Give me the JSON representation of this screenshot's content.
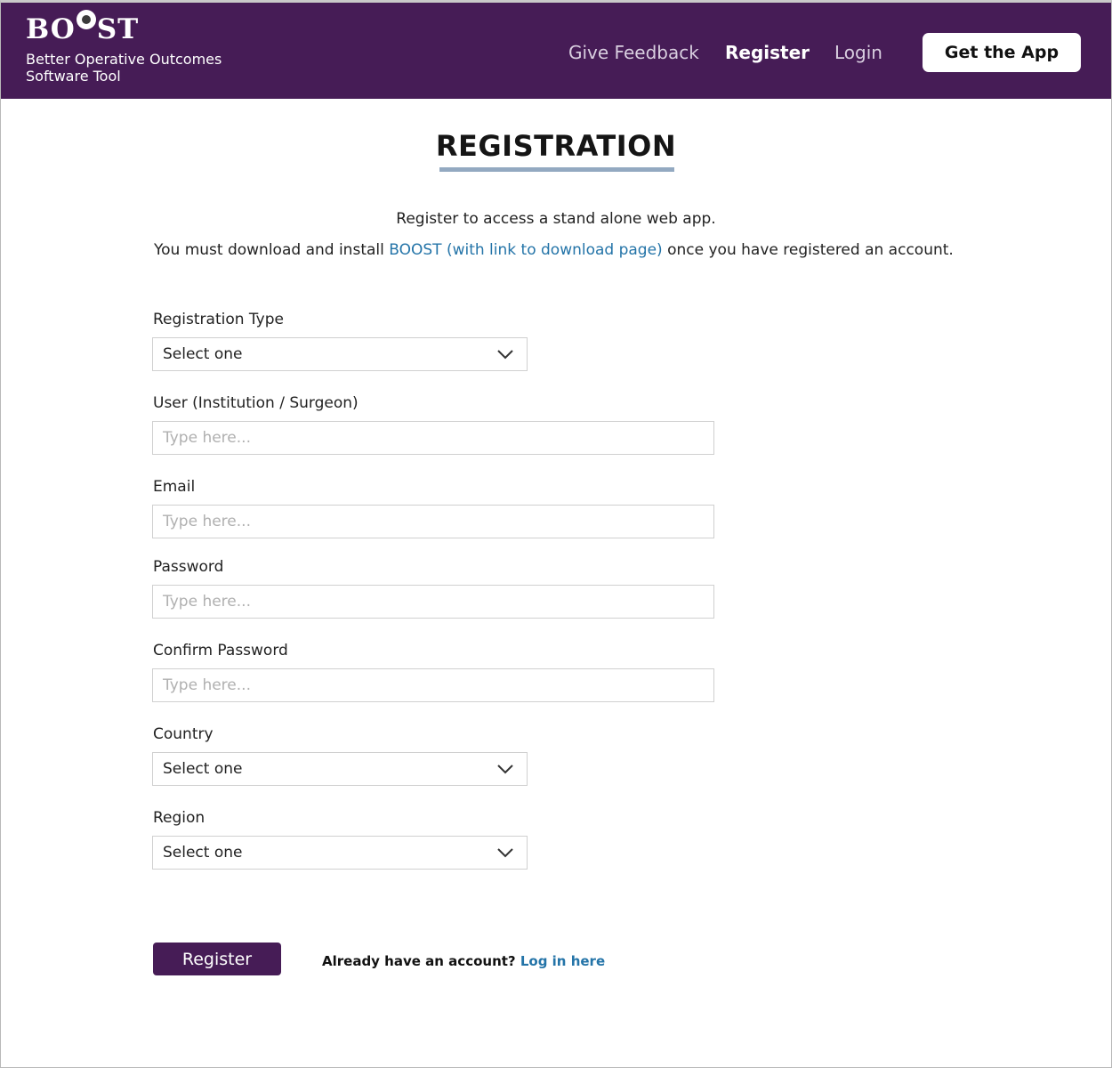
{
  "header": {
    "logo_text_left": "BO",
    "logo_text_right": "ST",
    "logo_sub_line1": "Better Operative Outcomes",
    "logo_sub_line2": "Software Tool",
    "nav": {
      "feedback": "Give Feedback",
      "register": "Register",
      "login": "Login"
    },
    "get_app": "Get the App"
  },
  "page": {
    "title": "REGISTRATION",
    "intro1": "Register to access a stand alone web app.",
    "intro2_pre": "You must download and install ",
    "intro2_link": "BOOST (with link to download page)",
    "intro2_post": " once you have registered an account."
  },
  "form": {
    "registration_type": {
      "label": "Registration Type",
      "value": "Select one"
    },
    "user": {
      "label": "User (Institution / Surgeon)",
      "placeholder": "Type here..."
    },
    "email": {
      "label": "Email",
      "placeholder": "Type here..."
    },
    "password": {
      "label": "Password",
      "placeholder": "Type here..."
    },
    "confirm_password": {
      "label": "Confirm Password",
      "placeholder": "Type here..."
    },
    "country": {
      "label": "Country",
      "value": "Select one"
    },
    "region": {
      "label": "Region",
      "value": "Select one"
    },
    "submit": "Register",
    "already_text": "Already have an account? ",
    "login_link": "Log in here"
  },
  "colors": {
    "brand_purple": "#461c56",
    "link_blue": "#2474a8",
    "title_underline": "#93a9c1"
  }
}
